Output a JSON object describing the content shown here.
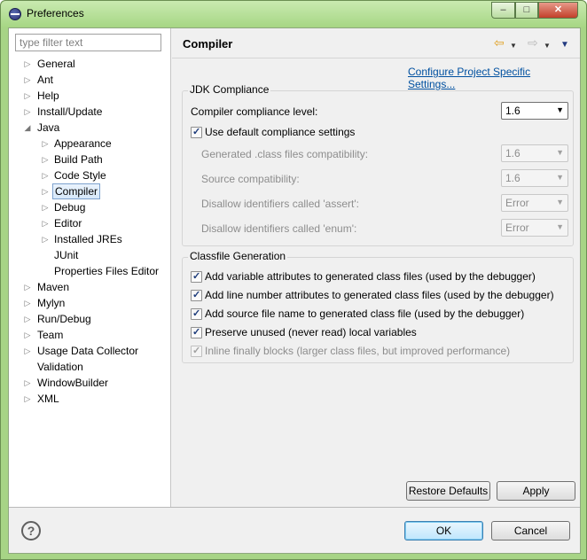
{
  "window": {
    "title": "Preferences",
    "controls": {
      "minimize": "–",
      "maximize": "□",
      "close": "✕"
    }
  },
  "filter": {
    "placeholder": "type filter text",
    "value": ""
  },
  "tree": [
    {
      "label": "General",
      "expandable": true
    },
    {
      "label": "Ant",
      "expandable": true
    },
    {
      "label": "Help",
      "expandable": true
    },
    {
      "label": "Install/Update",
      "expandable": true
    },
    {
      "label": "Java",
      "expanded": true
    },
    {
      "label": "Appearance",
      "expandable": true
    },
    {
      "label": "Build Path",
      "expandable": true
    },
    {
      "label": "Code Style",
      "expandable": true
    },
    {
      "label": "Compiler",
      "expandable": true,
      "selected": true
    },
    {
      "label": "Debug",
      "expandable": true
    },
    {
      "label": "Editor",
      "expandable": true
    },
    {
      "label": "Installed JREs",
      "expandable": true
    },
    {
      "label": "JUnit",
      "expandable": false
    },
    {
      "label": "Properties Files Editor",
      "expandable": false
    },
    {
      "label": "Maven",
      "expandable": true
    },
    {
      "label": "Mylyn",
      "expandable": true
    },
    {
      "label": "Run/Debug",
      "expandable": true
    },
    {
      "label": "Team",
      "expandable": true
    },
    {
      "label": "Usage Data Collector",
      "expandable": true
    },
    {
      "label": "Validation",
      "expandable": false
    },
    {
      "label": "WindowBuilder",
      "expandable": true
    },
    {
      "label": "XML",
      "expandable": true
    }
  ],
  "page": {
    "title": "Compiler",
    "configure_link": "Configure Project Specific Settings...",
    "nav": {
      "back_icon": "⇦",
      "forward_icon": "⇨",
      "dropdown_icon": "▼",
      "menu_icon": "▼"
    }
  },
  "jdk": {
    "group_title": "JDK Compliance",
    "compliance_label": "Compiler compliance level:",
    "compliance_value": "1.6",
    "use_default_label": "Use default compliance settings",
    "use_default_checked": true,
    "generated_label": "Generated .class files compatibility:",
    "generated_value": "1.6",
    "source_label": "Source compatibility:",
    "source_value": "1.6",
    "assert_label": "Disallow identifiers called 'assert':",
    "assert_value": "Error",
    "enum_label": "Disallow identifiers called 'enum':",
    "enum_value": "Error"
  },
  "classfile": {
    "group_title": "Classfile Generation",
    "options": [
      {
        "label": "Add variable attributes to generated class files (used by the debugger)",
        "checked": true,
        "enabled": true
      },
      {
        "label": "Add line number attributes to generated class files (used by the debugger)",
        "checked": true,
        "enabled": true
      },
      {
        "label": "Add source file name to generated class file (used by the debugger)",
        "checked": true,
        "enabled": true
      },
      {
        "label": "Preserve unused (never read) local variables",
        "checked": true,
        "enabled": true
      },
      {
        "label": "Inline finally blocks (larger class files, but improved performance)",
        "checked": true,
        "enabled": false
      }
    ]
  },
  "buttons": {
    "restore_defaults": "Restore Defaults",
    "apply": "Apply",
    "ok": "OK",
    "cancel": "Cancel"
  },
  "help_icon": "?"
}
